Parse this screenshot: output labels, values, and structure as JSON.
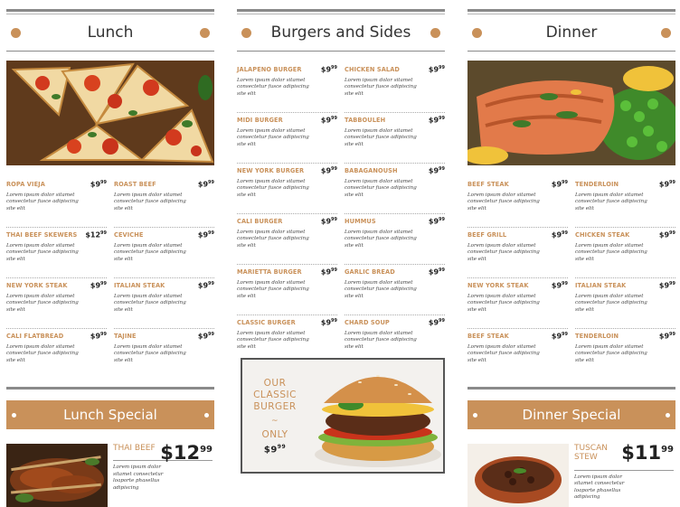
{
  "lunch": {
    "title": "Lunch",
    "items": [
      {
        "name": "ROPA VIEJA",
        "price": "$9",
        "cents": "99",
        "desc": "Lorem ipsum dolor sitamet consectetur fusce adipiscing site elit"
      },
      {
        "name": "ROAST BEEF",
        "price": "$9",
        "cents": "99",
        "desc": "Lorem ipsum dolor sitamet consectetur fusce adipiscing site elit"
      },
      {
        "name": "THAI BEEF SKEWERS",
        "price": "$12",
        "cents": "99",
        "desc": "Lorem ipsum dolor sitamet consectetur fusce adipiscing site elit"
      },
      {
        "name": "CEVICHE",
        "price": "$9",
        "cents": "99",
        "desc": "Lorem ipsum dolor sitamet consectetur fusce adipiscing site elit"
      },
      {
        "name": "NEW YORK STEAK",
        "price": "$9",
        "cents": "99",
        "desc": "Lorem ipsum dolor sitamet consectetur fusce adipiscing site elit"
      },
      {
        "name": "ITALIAN STEAK",
        "price": "$9",
        "cents": "99",
        "desc": "Lorem ipsum dolor sitamet consectetur fusce adipiscing site elit"
      },
      {
        "name": "CALI FLATBREAD",
        "price": "$9",
        "cents": "99",
        "desc": "Lorem ipsum dolor sitamet consectetur fusce adipiscing site elit"
      },
      {
        "name": "TAJINE",
        "price": "$9",
        "cents": "99",
        "desc": "Lorem ipsum dolor sitamet consectetur fusce adipiscing site elit"
      }
    ],
    "special_title": "Lunch Special",
    "special_name": "THAI BEEF",
    "special_price": "$12",
    "special_cents": "99",
    "special_desc": "Lorem ipsum dolor sitamet consectetur loaporte phasellus adipiscing"
  },
  "burgers": {
    "title": "Burgers and Sides",
    "items": [
      {
        "name": "JALAPENO BURGER",
        "price": "$9",
        "cents": "99",
        "desc": "Lorem ipsum dolor sitamet consectetur fusce adipiscing site elit"
      },
      {
        "name": "CHICKEN SALAD",
        "price": "$9",
        "cents": "99",
        "desc": "Lorem ipsum dolor sitamet consectetur fusce adipiscing site elit"
      },
      {
        "name": "MIDI BURGER",
        "price": "$9",
        "cents": "99",
        "desc": "Lorem ipsum dolor sitamet consectetur fusce adipiscing site elit"
      },
      {
        "name": "TABBOULEH",
        "price": "$9",
        "cents": "99",
        "desc": "Lorem ipsum dolor sitamet consectetur fusce adipiscing site elit"
      },
      {
        "name": "NEW YORK BURGER",
        "price": "$9",
        "cents": "99",
        "desc": "Lorem ipsum dolor sitamet consectetur fusce adipiscing site elit"
      },
      {
        "name": "BABAGANOUSH",
        "price": "$9",
        "cents": "99",
        "desc": "Lorem ipsum dolor sitamet consectetur fusce adipiscing site elit"
      },
      {
        "name": "CALI BURGER",
        "price": "$9",
        "cents": "99",
        "desc": "Lorem ipsum dolor sitamet consectetur fusce adipiscing site elit"
      },
      {
        "name": "HUMMUS",
        "price": "$9",
        "cents": "99",
        "desc": "Lorem ipsum dolor sitamet consectetur fusce adipiscing site elit"
      },
      {
        "name": "MARIETTA BURGER",
        "price": "$9",
        "cents": "99",
        "desc": "Lorem ipsum dolor sitamet consectetur fusce adipiscing site elit"
      },
      {
        "name": "GARLIC BREAD",
        "price": "$9",
        "cents": "99",
        "desc": "Lorem ipsum dolor sitamet consectetur fusce adipiscing site elit"
      },
      {
        "name": "CLASSIC BURGER",
        "price": "$9",
        "cents": "99",
        "desc": "Lorem ipsum dolor sitamet consectetur fusce adipiscing site elit"
      },
      {
        "name": "CHARD SOUP",
        "price": "$9",
        "cents": "99",
        "desc": "Lorem ipsum dolor sitamet consectetur fusce adipiscing site elit"
      }
    ],
    "promo_line1": "OUR",
    "promo_line2": "CLASSIC",
    "promo_line3": "BURGER",
    "promo_tilde": "~",
    "promo_only": "ONLY",
    "promo_price": "$9",
    "promo_cents": "99"
  },
  "dinner": {
    "title": "Dinner",
    "items": [
      {
        "name": "BEEF STEAK",
        "price": "$9",
        "cents": "99",
        "desc": "Lorem ipsum dolor sitamet consectetur fusce adipiscing site elit"
      },
      {
        "name": "TENDERLOIN",
        "price": "$9",
        "cents": "99",
        "desc": "Lorem ipsum dolor sitamet consectetur fusce adipiscing site elit"
      },
      {
        "name": "BEEF GRILL",
        "price": "$9",
        "cents": "99",
        "desc": "Lorem ipsum dolor sitamet consectetur fusce adipiscing site elit"
      },
      {
        "name": "CHICKEN STEAK",
        "price": "$9",
        "cents": "99",
        "desc": "Lorem ipsum dolor sitamet consectetur fusce adipiscing site elit"
      },
      {
        "name": "NEW YORK STEAK",
        "price": "$9",
        "cents": "99",
        "desc": "Lorem ipsum dolor sitamet consectetur fusce adipiscing site elit"
      },
      {
        "name": "ITALIAN STEAK",
        "price": "$9",
        "cents": "99",
        "desc": "Lorem ipsum dolor sitamet consectetur fusce adipiscing site elit"
      },
      {
        "name": "BEEF STEAK",
        "price": "$9",
        "cents": "99",
        "desc": "Lorem ipsum dolor sitamet consectetur fusce adipiscing site elit"
      },
      {
        "name": "TENDERLOIN",
        "price": "$9",
        "cents": "99",
        "desc": "Lorem ipsum dolor sitamet consectetur fusce adipiscing site elit"
      }
    ],
    "special_title": "Dinner Special",
    "special_name": "TUSCAN STEW",
    "special_price": "$11",
    "special_cents": "99",
    "special_desc": "Lorem ipsum dolor sitamet consectetur loaporte phasellus adipiscing"
  },
  "colors": {
    "accent": "#c9915a",
    "rule": "#8a8a8a",
    "text": "#333333"
  }
}
